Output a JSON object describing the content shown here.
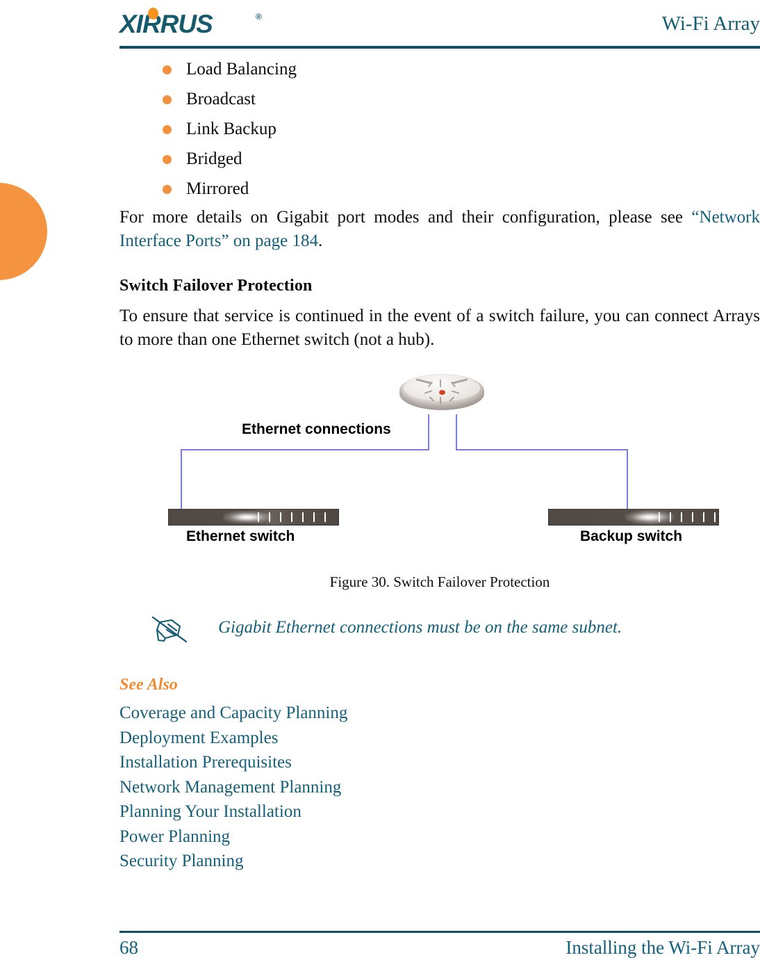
{
  "header": {
    "logo_text": "XIRRUS",
    "logo_registered": "®",
    "title": "Wi-Fi Array"
  },
  "bullets": [
    {
      "label": "Load Balancing"
    },
    {
      "label": "Broadcast"
    },
    {
      "label": "Link Backup"
    },
    {
      "label": "Bridged"
    },
    {
      "label": "Mirrored"
    }
  ],
  "intro_paragraph": {
    "text_before": "For more details on Gigabit port modes and their configuration, please see ",
    "xref": "“Network Interface Ports” on page 184",
    "text_after": "."
  },
  "section": {
    "heading": "Switch Failover Protection",
    "body": "To ensure that service is continued in the event of a switch failure, you can connect Arrays to more than one Ethernet switch (not a hub)."
  },
  "figure": {
    "labels": {
      "ethernet_connections": "Ethernet connections",
      "ethernet_switch": "Ethernet switch",
      "backup_switch": "Backup switch"
    },
    "caption": "Figure 30. Switch Failover Protection",
    "colors": {
      "connector_line": "#7C7CE0",
      "switch_body": "#514944",
      "array_led": "#d8442a"
    }
  },
  "note": {
    "icon": "note-pen-icon",
    "text": "Gigabit Ethernet connections must be on the same subnet."
  },
  "see_also": {
    "heading": "See Also",
    "items": [
      {
        "label": "Coverage and Capacity Planning"
      },
      {
        "label": "Deployment Examples"
      },
      {
        "label": "Installation Prerequisites"
      },
      {
        "label": "Network Management Planning"
      },
      {
        "label": "Planning Your Installation"
      },
      {
        "label": "Power Planning"
      },
      {
        "label": "Security Planning"
      }
    ]
  },
  "footer": {
    "page_number": "68",
    "title": "Installing the Wi-Fi Array"
  },
  "theme": {
    "accent_teal": "#14607A",
    "accent_orange": "#F3913E",
    "rule_color": "#105065"
  }
}
